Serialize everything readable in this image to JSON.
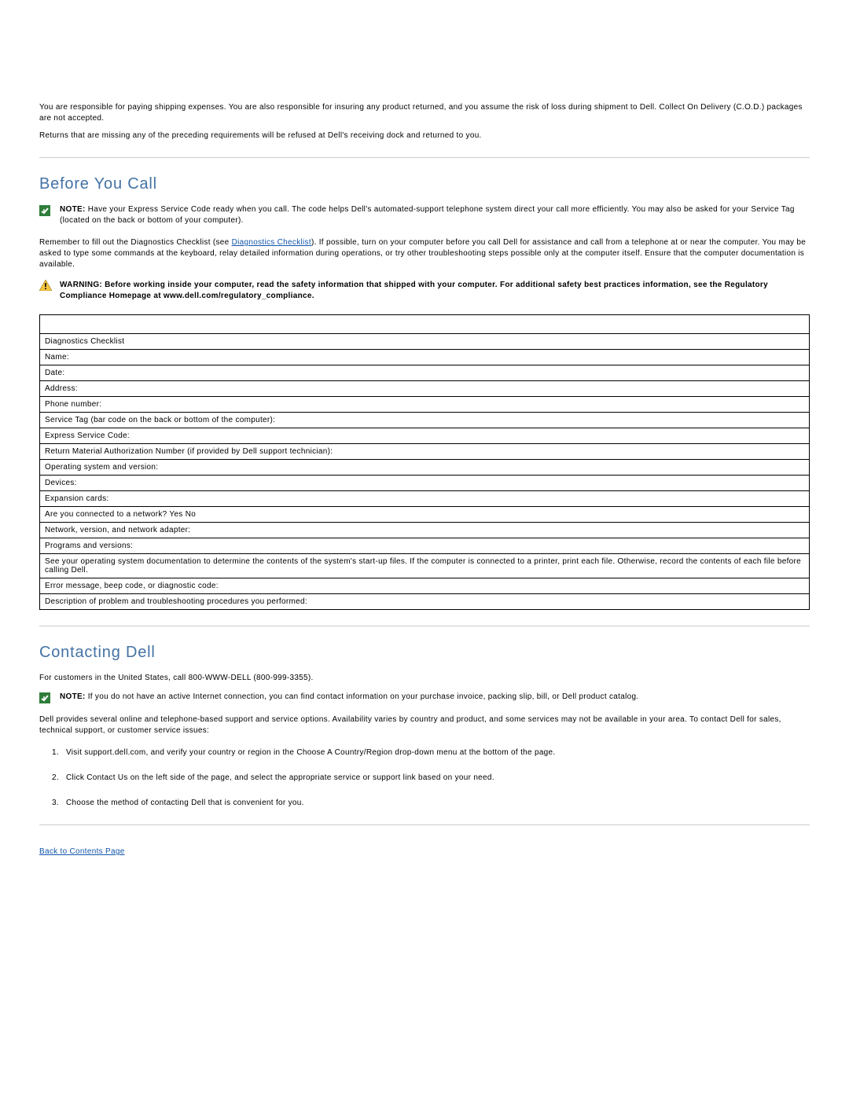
{
  "intro": {
    "p1": "You are responsible for paying shipping expenses. You are also responsible for insuring any product returned, and you assume the risk of loss during shipment to Dell. Collect On Delivery (C.O.D.) packages are not accepted.",
    "p2": "Returns that are missing any of the preceding requirements will be refused at Dell's receiving dock and returned to you."
  },
  "section1": {
    "heading": "Before You Call",
    "note_label": "NOTE:",
    "note_text": " Have your Express Service Code ready when you call. The code helps Dell's automated-support telephone system direct your call more efficiently. You may also be asked for your Service Tag (located on the back or bottom of your computer).",
    "para_pre": "Remember to fill out the Diagnostics Checklist (see ",
    "para_link": "Diagnostics Checklist",
    "para_post": "). If possible, turn on your computer before you call Dell for assistance and call from a telephone at or near the computer. You may be asked to type some commands at the keyboard, relay detailed information during operations, or try other troubleshooting steps possible only at the computer itself. Ensure that the computer documentation is available.",
    "warning_label": "WARNING:",
    "warning_text": " Before working inside your computer, read the safety information that shipped with your computer. For additional safety best practices information, see the Regulatory Compliance Homepage at www.dell.com/regulatory_compliance."
  },
  "checklist": {
    "rows": [
      "Diagnostics Checklist",
      "Name:",
      "Date:",
      "Address:",
      "Phone number:",
      "Service Tag (bar code on the back or bottom of the computer):",
      "Express Service Code:",
      "Return Material Authorization Number (if provided by Dell support technician):",
      "Operating system and version:",
      "Devices:",
      "Expansion cards:",
      "Are you connected to a network? Yes No",
      "Network, version, and network adapter:",
      "Programs and versions:",
      "See your operating system documentation to determine the contents of the system's start-up files. If the computer is connected to a printer, print each file. Otherwise, record the contents of each file before calling Dell.",
      "Error message, beep code, or diagnostic code:",
      "Description of problem and troubleshooting procedures you performed:"
    ]
  },
  "section2": {
    "heading": "Contacting Dell",
    "p1": "For customers in the United States, call 800-WWW-DELL (800-999-3355).",
    "note_label": "NOTE:",
    "note_text": " If you do not have an active Internet connection, you can find contact information on your purchase invoice, packing slip, bill, or Dell product catalog.",
    "p2": "Dell provides several online and telephone-based support and service options. Availability varies by country and product, and some services may not be available in your area. To contact Dell for sales, technical support, or customer service issues:",
    "steps": [
      "Visit support.dell.com, and verify your country or region in the Choose A Country/Region drop-down menu at the bottom of the page.",
      "Click Contact Us on the left side of the page, and select the appropriate service or support link based on your need.",
      "Choose the method of contacting Dell that is convenient for you."
    ]
  },
  "footer": {
    "back_link": "Back to Contents Page"
  }
}
